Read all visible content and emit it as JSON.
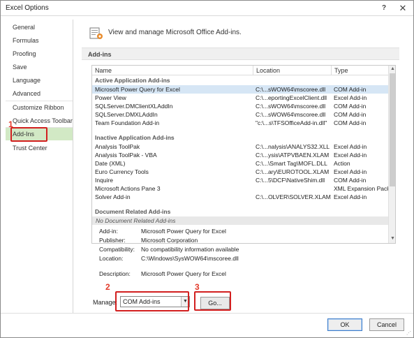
{
  "window": {
    "title": "Excel Options",
    "help": "?",
    "close": "✕"
  },
  "sidebar": {
    "items": [
      {
        "label": "General"
      },
      {
        "label": "Formulas"
      },
      {
        "label": "Proofing"
      },
      {
        "label": "Save"
      },
      {
        "label": "Language"
      },
      {
        "label": "Advanced"
      },
      {
        "label": "Customize Ribbon"
      },
      {
        "label": "Quick Access Toolbar"
      },
      {
        "label": "Add-Ins",
        "selected": true
      },
      {
        "label": "Trust Center"
      }
    ]
  },
  "main": {
    "header": "View and manage Microsoft Office Add-ins.",
    "section": "Add-ins",
    "columns": [
      "Name",
      "Location",
      "Type"
    ],
    "groups": [
      {
        "title": "Active Application Add-ins",
        "rows": [
          {
            "name": "Microsoft Power Query for Excel",
            "location": "C:\\...sWOW64\\mscoree.dll",
            "type": "COM Add-in",
            "selected": true
          },
          {
            "name": "Power View",
            "location": "C:\\...eportingExcelClient.dll",
            "type": "Excel Add-in"
          },
          {
            "name": "SQLServer.DMClientXLAddIn",
            "location": "C:\\...sWOW64\\mscoree.dll",
            "type": "COM Add-in"
          },
          {
            "name": "SQLServer.DMXLAddIn",
            "location": "C:\\...sWOW64\\mscoree.dll",
            "type": "COM Add-in"
          },
          {
            "name": "Team Foundation Add-in",
            "location": "\"c:\\...s\\TFSOfficeAdd-in.dll\"",
            "type": "COM Add-in"
          }
        ]
      },
      {
        "title": "Inactive Application Add-ins",
        "rows": [
          {
            "name": "Analysis ToolPak",
            "location": "C:\\...nalysis\\ANALYS32.XLL",
            "type": "Excel Add-in"
          },
          {
            "name": "Analysis ToolPak - VBA",
            "location": "C:\\...ysis\\ATPVBAEN.XLAM",
            "type": "Excel Add-in"
          },
          {
            "name": "Date (XML)",
            "location": "C:\\...\\Smart Tag\\MOFL.DLL",
            "type": "Action"
          },
          {
            "name": "Euro Currency Tools",
            "location": "C:\\...ary\\EUROTOOL.XLAM",
            "type": "Excel Add-in"
          },
          {
            "name": "Inquire",
            "location": "C:\\...5\\DCF\\NativeShim.dll",
            "type": "COM Add-in"
          },
          {
            "name": "Microsoft Actions Pane 3",
            "location": "",
            "type": "XML Expansion Pack"
          },
          {
            "name": "Solver Add-in",
            "location": "C:\\...OLVER\\SOLVER.XLAM",
            "type": "Excel Add-in"
          }
        ]
      },
      {
        "title": "Document Related Add-ins",
        "rows": [],
        "empty": "No Document Related Add-ins"
      }
    ],
    "details": [
      {
        "label": "Add-in:",
        "value": "Microsoft Power Query for Excel"
      },
      {
        "label": "Publisher:",
        "value": "Microsoft Corporation"
      },
      {
        "label": "Compatibility:",
        "value": "No compatibility information available"
      },
      {
        "label": "Location:",
        "value": "C:\\Windows\\SysWOW64\\mscoree.dll"
      },
      {
        "label": "",
        "value": ""
      },
      {
        "label": "Description:",
        "value": "Microsoft Power Query for Excel"
      }
    ],
    "manage": {
      "label": "Manage:",
      "value": "COM Add-ins",
      "go": "Go..."
    }
  },
  "markers": {
    "m1": "1",
    "m2": "2",
    "m3": "3"
  },
  "footer": {
    "ok": "OK",
    "cancel": "Cancel"
  },
  "colors": {
    "selected_nav": "#d2e9c5",
    "highlight": "#d21f1f",
    "marker": "#e23a2b",
    "selected_row": "#d6e6f5"
  }
}
